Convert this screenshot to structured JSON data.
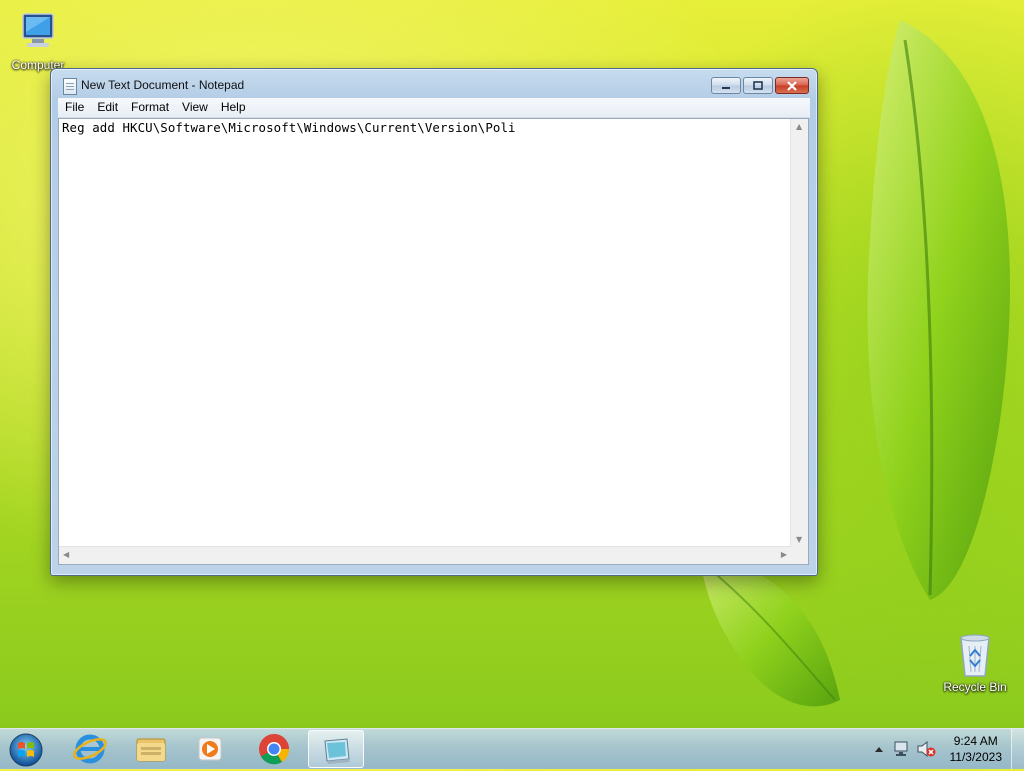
{
  "desktop": {
    "icons": [
      {
        "label": "Computer",
        "icon": "computer-icon"
      },
      {
        "label": "Recycle Bin",
        "icon": "recycle-bin-icon"
      }
    ]
  },
  "window": {
    "title": "New Text Document - Notepad",
    "menu": [
      "File",
      "Edit",
      "Format",
      "View",
      "Help"
    ],
    "content": "Reg add HKCU\\Software\\Microsoft\\Windows\\Current\\Version\\Poli"
  },
  "taskbar": {
    "pinned": [
      "start-orb-icon",
      "internet-explorer-icon",
      "file-explorer-icon",
      "media-player-icon",
      "chrome-icon",
      "notepad-icon"
    ],
    "tray_icons": [
      "show-hidden-icons-icon",
      "network-icon",
      "volume-muted-icon"
    ],
    "time": "9:24 AM",
    "date": "11/3/2023"
  },
  "colors": {
    "wallpaper_top": "#e7ef39",
    "wallpaper_bottom": "#86c81c",
    "window_frame": "#bcd3ea",
    "close_button": "#c73e26"
  }
}
